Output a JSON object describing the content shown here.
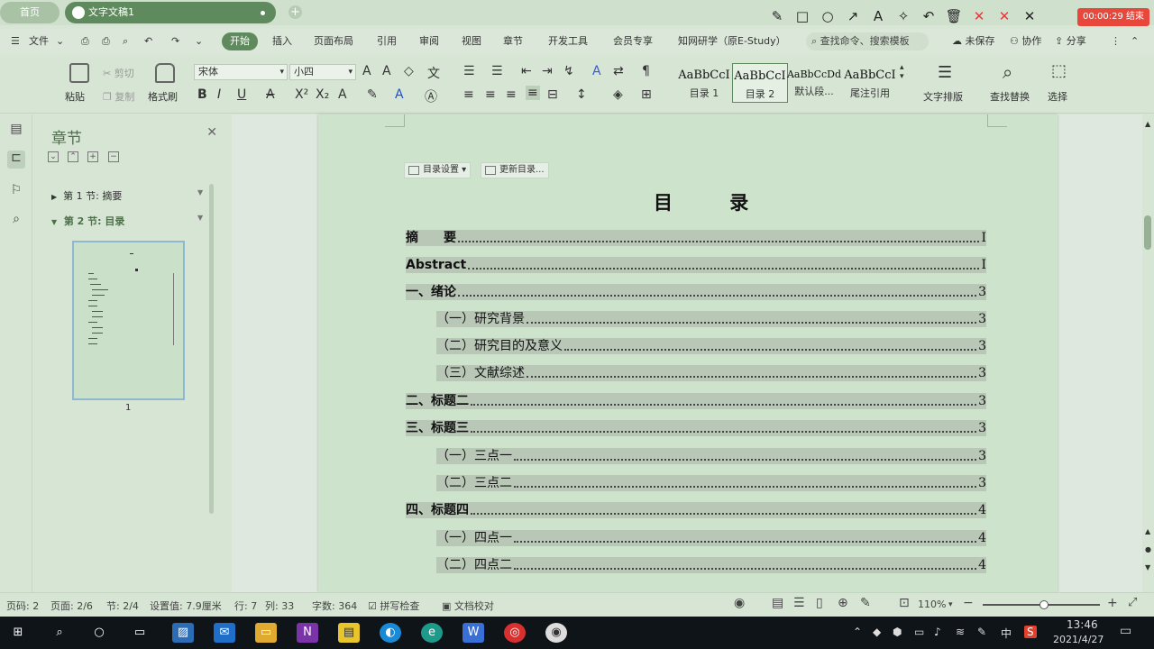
{
  "tabs": {
    "home": "首页",
    "doc": "文字文稿1"
  },
  "rec": {
    "time": "00:00:29 结束"
  },
  "menu": {
    "file": "文件",
    "items": [
      "开始",
      "插入",
      "页面布局",
      "引用",
      "审阅",
      "视图",
      "章节",
      "开发工具",
      "会员专享",
      "知网研学（原E-Study）"
    ],
    "search_placeholder": "查找命令、搜索模板",
    "unsaved": "未保存",
    "collab": "协作",
    "share": "分享"
  },
  "ribbon": {
    "paste": "粘贴",
    "cut": "剪切",
    "copy": "复制",
    "format_painter": "格式刷",
    "font_name": "宋体",
    "font_size": "小四",
    "styles": [
      {
        "preview": "AaBbCcI",
        "name": "目录 1"
      },
      {
        "preview": "AaBbCcI",
        "name": "目录 2"
      },
      {
        "preview": "AaBbCcDd",
        "name": "默认段..."
      },
      {
        "preview": "AaBbCcI",
        "name": "尾注引用"
      }
    ],
    "text_layout": "文字排版",
    "find_replace": "查找替换",
    "select": "选择"
  },
  "panel": {
    "title": "章节",
    "sections": [
      {
        "label": "第 1 节: 摘要",
        "active": false
      },
      {
        "label": "第 2 节: 目录",
        "active": true
      }
    ],
    "thumb_page": "1"
  },
  "toc_tools": {
    "settings": "目录设置",
    "update": "更新目录..."
  },
  "document": {
    "title": "目 录",
    "entries": [
      {
        "text": "摘　　要",
        "page": "I",
        "level": 1
      },
      {
        "text": "Abstract",
        "page": "I",
        "level": 1
      },
      {
        "text": "一、绪论",
        "page": "3",
        "level": 1
      },
      {
        "text": "（一）研究背景",
        "page": "3",
        "level": 2
      },
      {
        "text": "（二）研究目的及意义",
        "page": "3",
        "level": 2
      },
      {
        "text": "（三）文献综述",
        "page": "3",
        "level": 2
      },
      {
        "text": "二、标题二",
        "page": "3",
        "level": 1
      },
      {
        "text": "三、标题三",
        "page": "3",
        "level": 1
      },
      {
        "text": "（一）三点一",
        "page": "3",
        "level": 2
      },
      {
        "text": "（二）三点二",
        "page": "3",
        "level": 2
      },
      {
        "text": "四、标题四",
        "page": "4",
        "level": 1
      },
      {
        "text": "（一）四点一",
        "page": "4",
        "level": 2
      },
      {
        "text": "（二）四点二",
        "page": "4",
        "level": 2
      }
    ]
  },
  "status": {
    "page_code": "页码: 2",
    "pages": "页面: 2/6",
    "section": "节: 2/4",
    "setting": "设置值: 7.9厘米",
    "row": "行: 7",
    "col": "列: 33",
    "words": "字数: 364",
    "spell": "拼写检查",
    "proof": "文档校对",
    "zoom": "110%",
    "zoom_level": 0.52
  },
  "taskbar": {
    "time": "13:46",
    "date": "2021/4/27",
    "ime": "中"
  }
}
